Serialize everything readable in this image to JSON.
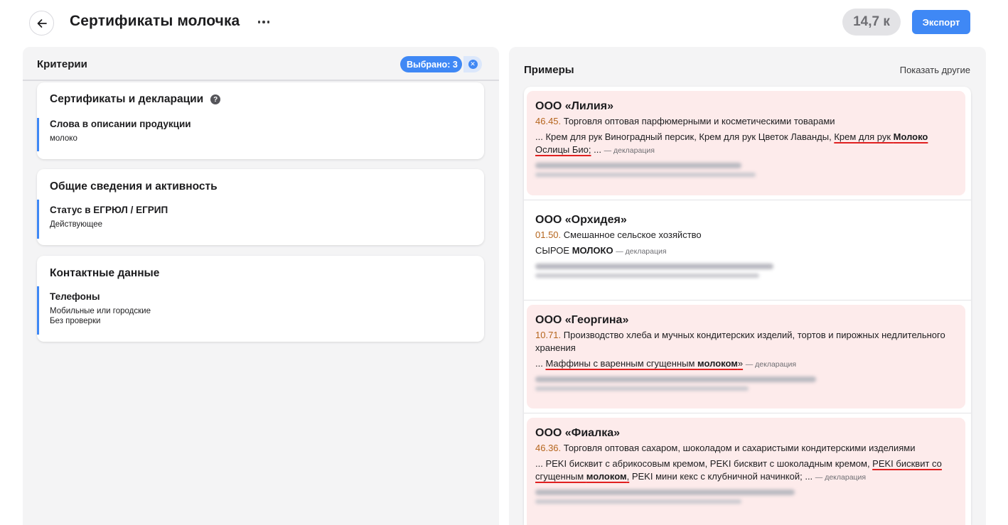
{
  "header": {
    "title": "Сертификаты молочка",
    "count": "14,7 к",
    "export_label": "Экспорт"
  },
  "criteria": {
    "title": "Критерии",
    "selected_label": "Выбрано: 3",
    "clear_glyph": "✕",
    "help_glyph": "?",
    "cards": [
      {
        "title": "Сертификаты и декларации",
        "items": [
          {
            "label": "Слова в описании продукции",
            "values": [
              "молоко"
            ]
          }
        ]
      },
      {
        "title": "Общие сведения и активность",
        "items": [
          {
            "label": "Статус в ЕГРЮЛ / ЕГРИП",
            "values": [
              "Действующее"
            ]
          }
        ]
      },
      {
        "title": "Контактные данные",
        "items": [
          {
            "label": "Телефоны",
            "values": [
              "Мобильные или городские",
              "Без проверки"
            ]
          }
        ]
      }
    ]
  },
  "examples": {
    "title": "Примеры",
    "show_more_label": "Показать другие",
    "doc_type": "— декларация",
    "items": [
      {
        "name": "ООО «Лилия»",
        "okved_code": "46.45.",
        "okved_text": "Торговля оптовая парфюмерными и косметическими товарами",
        "snippet_pre": "... Крем для рук Виноградный персик, Крем для рук Цветок Лаванды, ",
        "snippet_u_pre": "Крем для рук ",
        "snippet_bold": "Молоко",
        "snippet_u_post": " Ослицы Био;",
        "snippet_post": " ...",
        "highlighted": true
      },
      {
        "name": "ООО «Орхидея»",
        "okved_code": "01.50.",
        "okved_text": "Смешанное сельское хозяйство",
        "snippet_pre": "СЫРОЕ ",
        "snippet_bold": "МОЛОКО",
        "highlighted": false
      },
      {
        "name": "ООО «Георгина»",
        "okved_code": "10.71.",
        "okved_text": "Производство хлеба и мучных кондитерских изделий, тортов и пирожных недлительного хранения",
        "snippet_pre": "... ",
        "snippet_u_pre": "Маффины с варенным сгущенным ",
        "snippet_bold": "молоком",
        "snippet_u_post": "»",
        "highlighted": true
      },
      {
        "name": "ООО «Фиалка»",
        "okved_code": "46.36.",
        "okved_text": "Торговля оптовая сахаром, шоколадом и сахаристыми кондитерскими изделиями",
        "snippet_pre": "... PEKI бисквит с абрикосовым кремом, PEKI бисквит с шоколадным кремом, ",
        "snippet_u_pre": "PEKI бисквит со сгущенным ",
        "snippet_bold": "молоком",
        "snippet_u_post": ",",
        "snippet_post": " PEKI мини кекс с клубничной начинкой; ...",
        "highlighted": true
      }
    ]
  },
  "colors": {
    "accent": "#3f88f5",
    "highlight_bg": "#fdebeb",
    "underline": "#e02020",
    "okved_code": "#b5651d"
  },
  "icons": {
    "back": "arrow-left-icon",
    "more": "more-horizontal-icon",
    "help": "question-circle-icon",
    "clear": "close-circle-icon"
  }
}
